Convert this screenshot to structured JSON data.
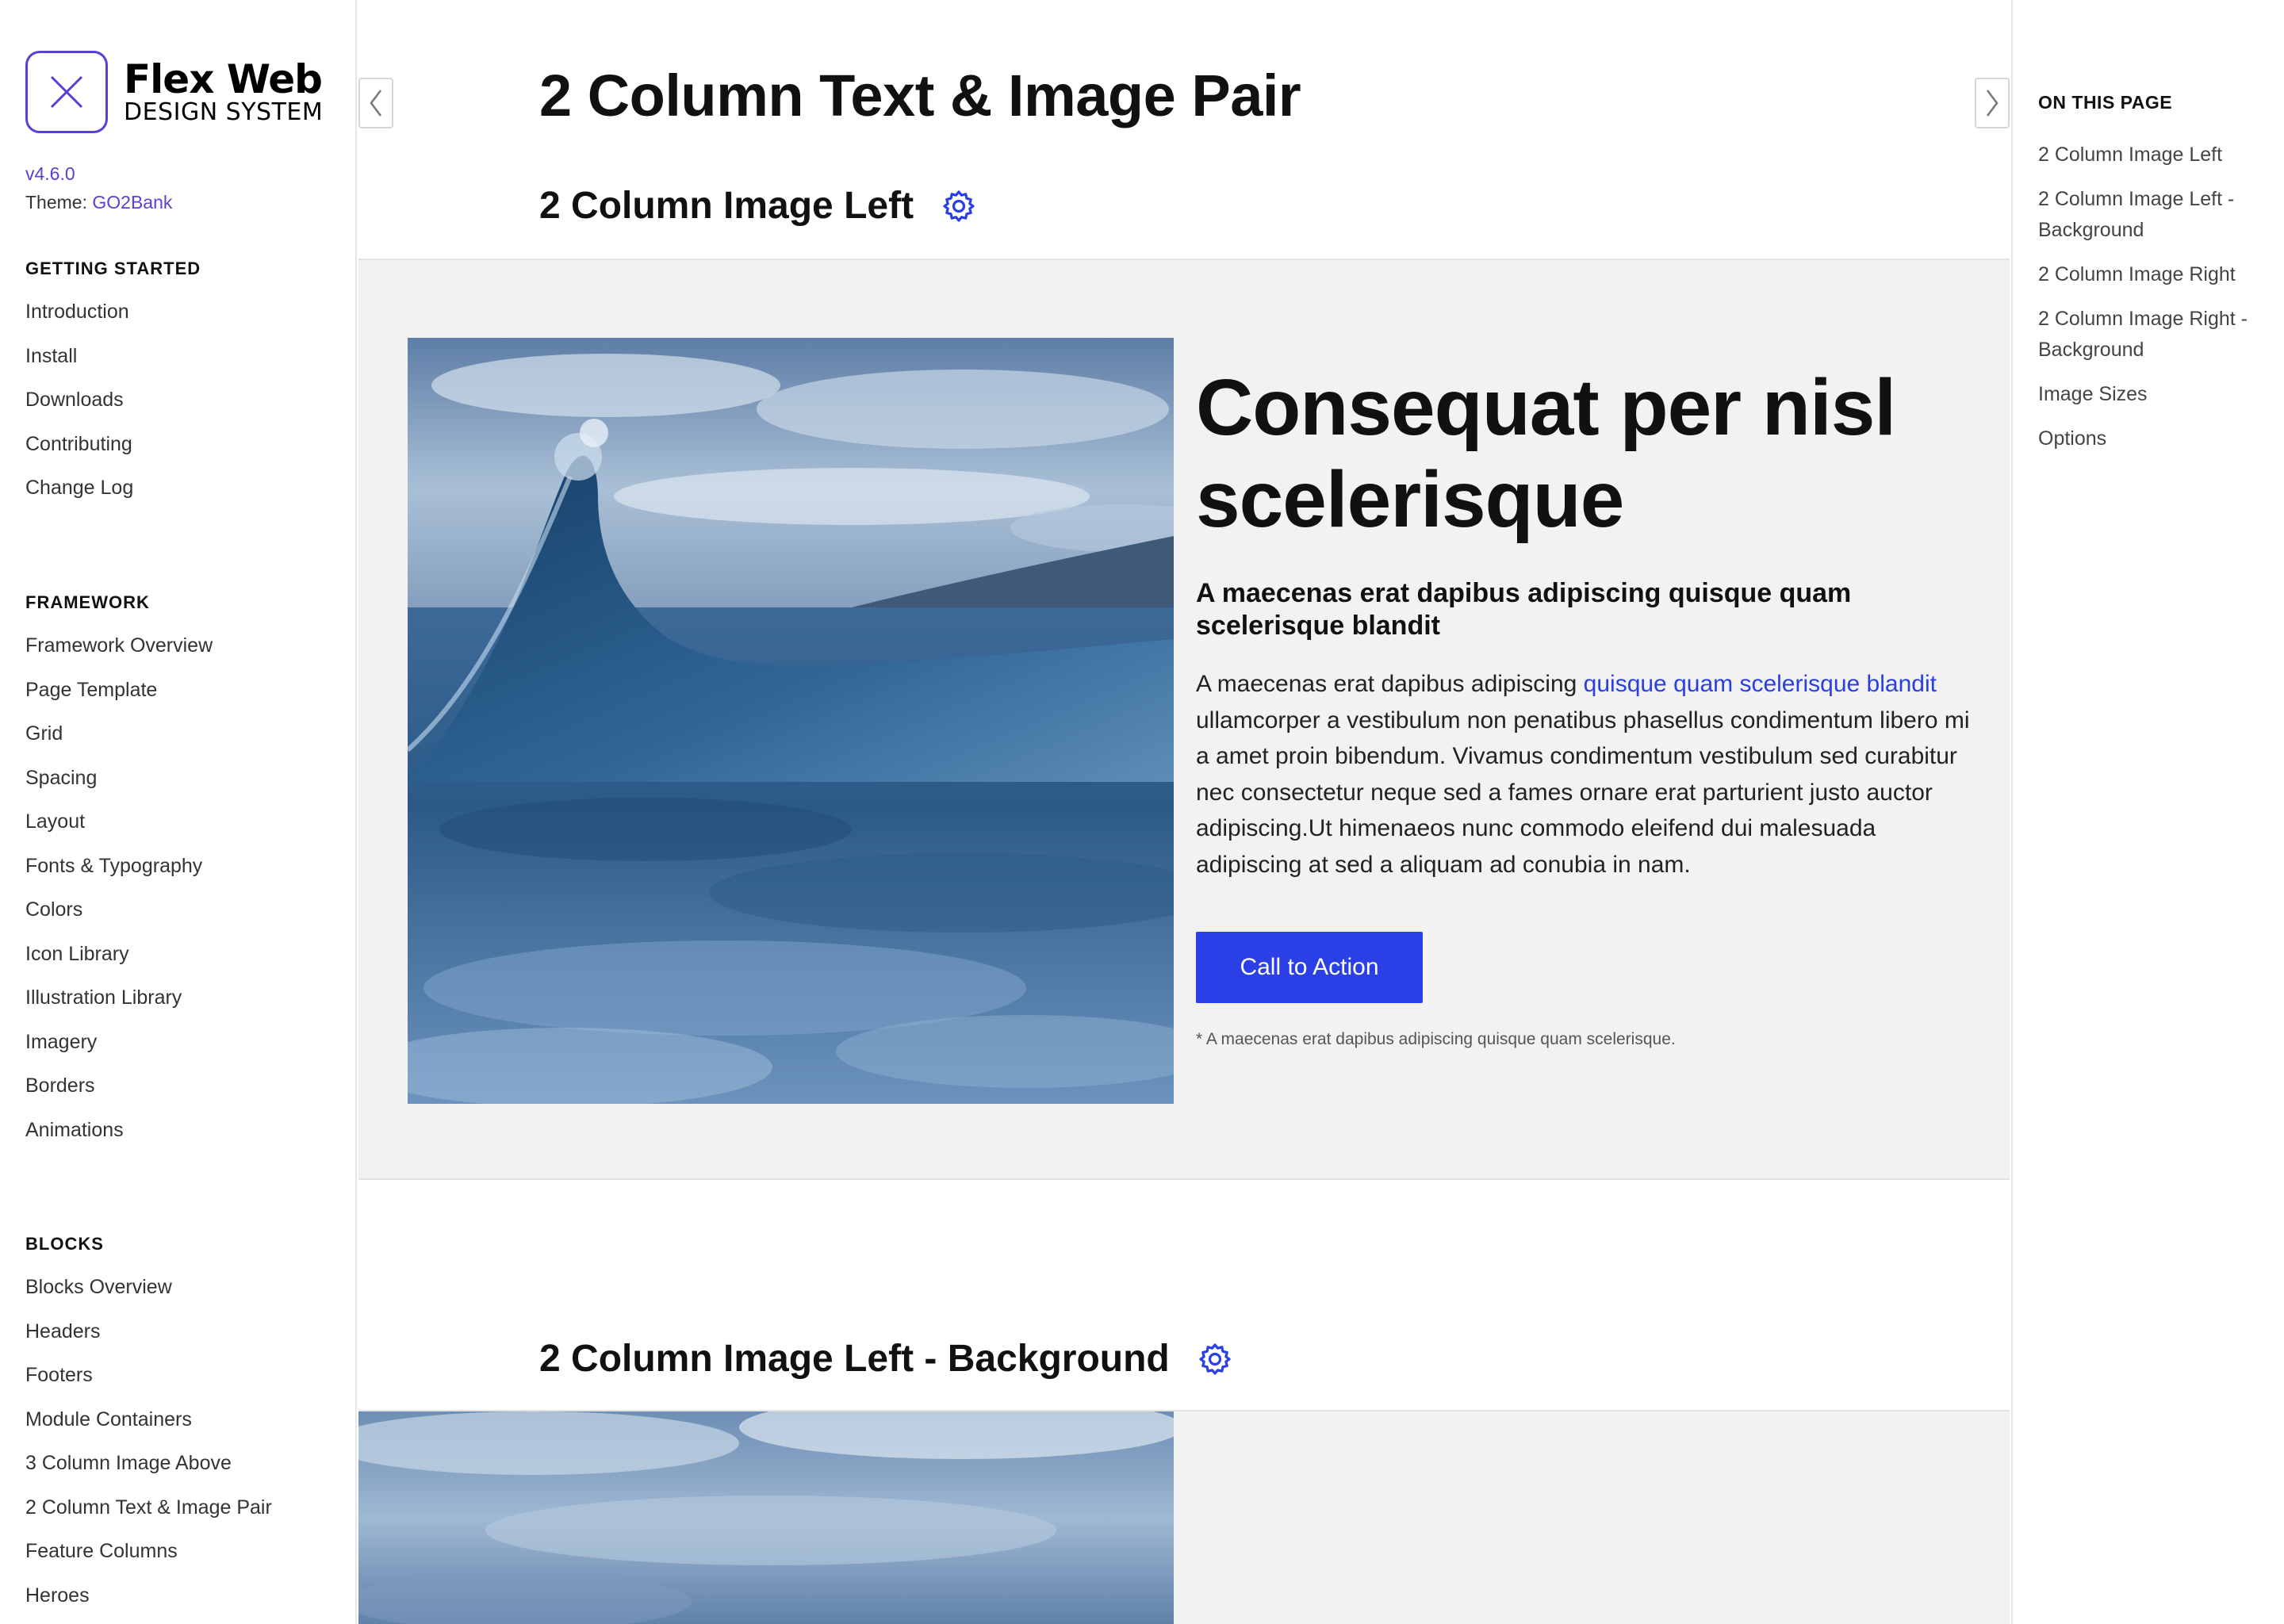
{
  "brand": {
    "title": "Flex Web",
    "subtitle": "DESIGN SYSTEM",
    "version": "v4.6.0",
    "theme_label": "Theme:",
    "theme_name": "GO2Bank",
    "accent": "#5b3fd6"
  },
  "sidebar": {
    "sections": [
      {
        "heading": "GETTING STARTED",
        "items": [
          "Introduction",
          "Install",
          "Downloads",
          "Contributing",
          "Change Log"
        ]
      },
      {
        "heading": "FRAMEWORK",
        "items": [
          "Framework Overview",
          "Page Template",
          "Grid",
          "Spacing",
          "Layout",
          "Fonts & Typography",
          "Colors",
          "Icon Library",
          "Illustration Library",
          "Imagery",
          "Borders",
          "Animations"
        ]
      },
      {
        "heading": "BLOCKS",
        "items": [
          "Blocks Overview",
          "Headers",
          "Footers",
          "Module Containers",
          "3 Column Image Above",
          "2 Column Text & Image Pair",
          "Feature Columns",
          "Heroes"
        ]
      }
    ]
  },
  "main": {
    "page_title": "2 Column Text & Image Pair",
    "sections": [
      {
        "title": "2 Column Image Left"
      },
      {
        "title": "2 Column Image Left - Background"
      }
    ],
    "demo": {
      "heading": "Consequat per nisl scelerisque",
      "subheading": "A maecenas erat dapibus adipiscing quisque quam scelerisque blandit",
      "body_before": "A maecenas erat dapibus adipiscing ",
      "body_link": "quisque quam scelerisque blandit",
      "body_after": " ullamcorper a vestibulum non penatibus phasellus condimentum libero mi a amet proin bibendum. Vivamus condimentum vestibulum sed curabitur nec consectetur neque sed a fames ornare erat parturient justo auctor adipiscing.Ut himenaeos nunc commodo eleifend dui malesuada adipiscing at sed a aliquam ad conubia in nam.",
      "cta_label": "Call to Action",
      "footnote": "* A maecenas erat dapibus adipiscing quisque quam scelerisque."
    },
    "button_color": "#2b3fe6",
    "link_color": "#2b3fe0"
  },
  "toc": {
    "heading": "ON THIS PAGE",
    "items": [
      "2 Column Image Left",
      "2 Column Image Left - Background",
      "2 Column Image Right",
      "2 Column Image Right - Background",
      "Image Sizes",
      "Options"
    ]
  },
  "icons": {
    "logo": "close-x-icon",
    "prev": "chevron-left-icon",
    "next": "chevron-right-icon",
    "settings": "gear-icon"
  }
}
